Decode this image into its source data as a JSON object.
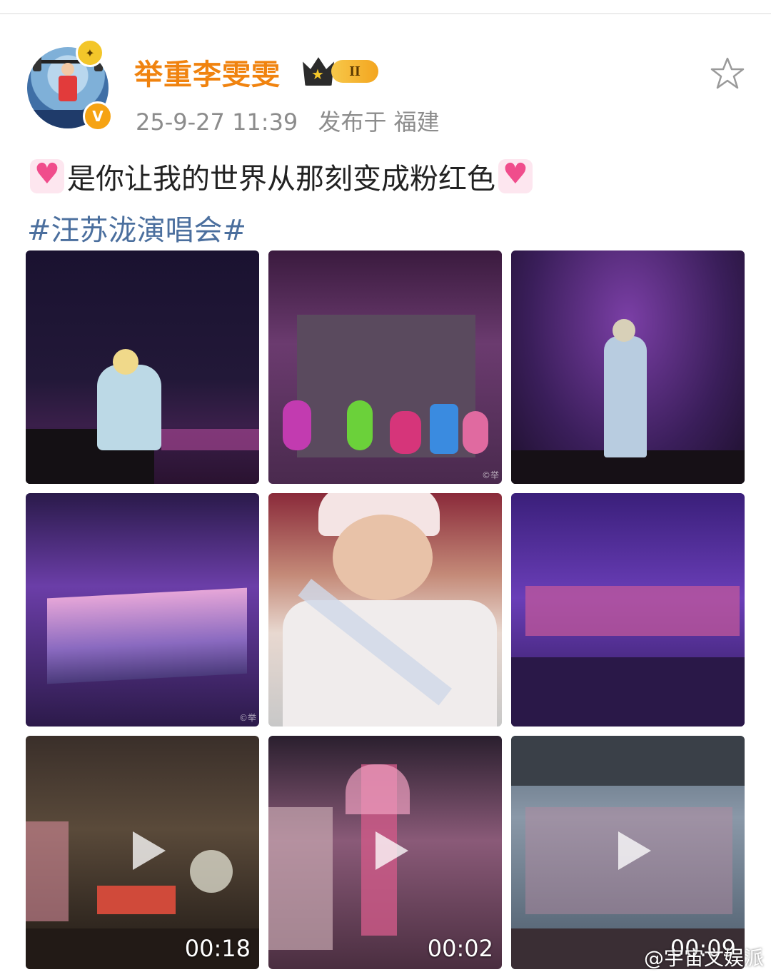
{
  "post": {
    "username": "举重李雯雯",
    "level_badge": "II",
    "date": "25-9-27 11:39",
    "location_label": "发布于 福建",
    "text": "是你让我的世界从那刻变成粉红色",
    "hashtag": "#汪苏泷演唱会#"
  },
  "media": [
    {
      "type": "image"
    },
    {
      "type": "image",
      "corner_label": "©举"
    },
    {
      "type": "image"
    },
    {
      "type": "image",
      "corner_label": "©举"
    },
    {
      "type": "image"
    },
    {
      "type": "image"
    },
    {
      "type": "video",
      "duration": "00:18"
    },
    {
      "type": "video",
      "duration": "00:02"
    },
    {
      "type": "video",
      "duration": "00:09"
    }
  ],
  "watermark": "@宇宙文娱派",
  "colors": {
    "username": "#f0830f",
    "hashtag": "#4b6f9e",
    "meta": "#8c8c8c",
    "verified": "#f6a313"
  },
  "icons": [
    "star-icon",
    "crown-icon",
    "verified-icon",
    "play-icon",
    "heart-emoji-icon"
  ]
}
